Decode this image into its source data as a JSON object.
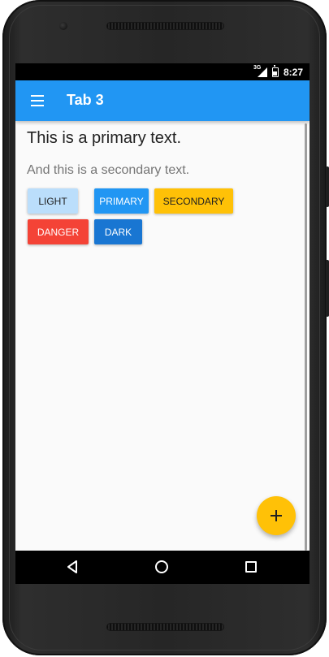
{
  "status_bar": {
    "network_label": "3G",
    "time": "8:27"
  },
  "app_bar": {
    "title": "Tab 3",
    "menu_icon": "menu-icon"
  },
  "content": {
    "primary_text": "This is a primary text.",
    "secondary_text": "And this is a secondary text."
  },
  "buttons": [
    {
      "label": "LIGHT",
      "color": "#bbdefb"
    },
    {
      "label": "PRIMARY",
      "color": "#2196f3"
    },
    {
      "label": "SECONDARY",
      "color": "#ffc107"
    },
    {
      "label": "DANGER",
      "color": "#f44336"
    },
    {
      "label": "DARK",
      "color": "#1976d2"
    }
  ],
  "fab": {
    "icon": "plus-icon",
    "color": "#ffc107"
  },
  "nav_bar": {
    "back_icon": "back-triangle-icon",
    "home_icon": "home-circle-icon",
    "recents_icon": "recents-square-icon"
  },
  "colors": {
    "accent": "#2196f3",
    "fab": "#ffc107",
    "background": "#fafafa"
  }
}
